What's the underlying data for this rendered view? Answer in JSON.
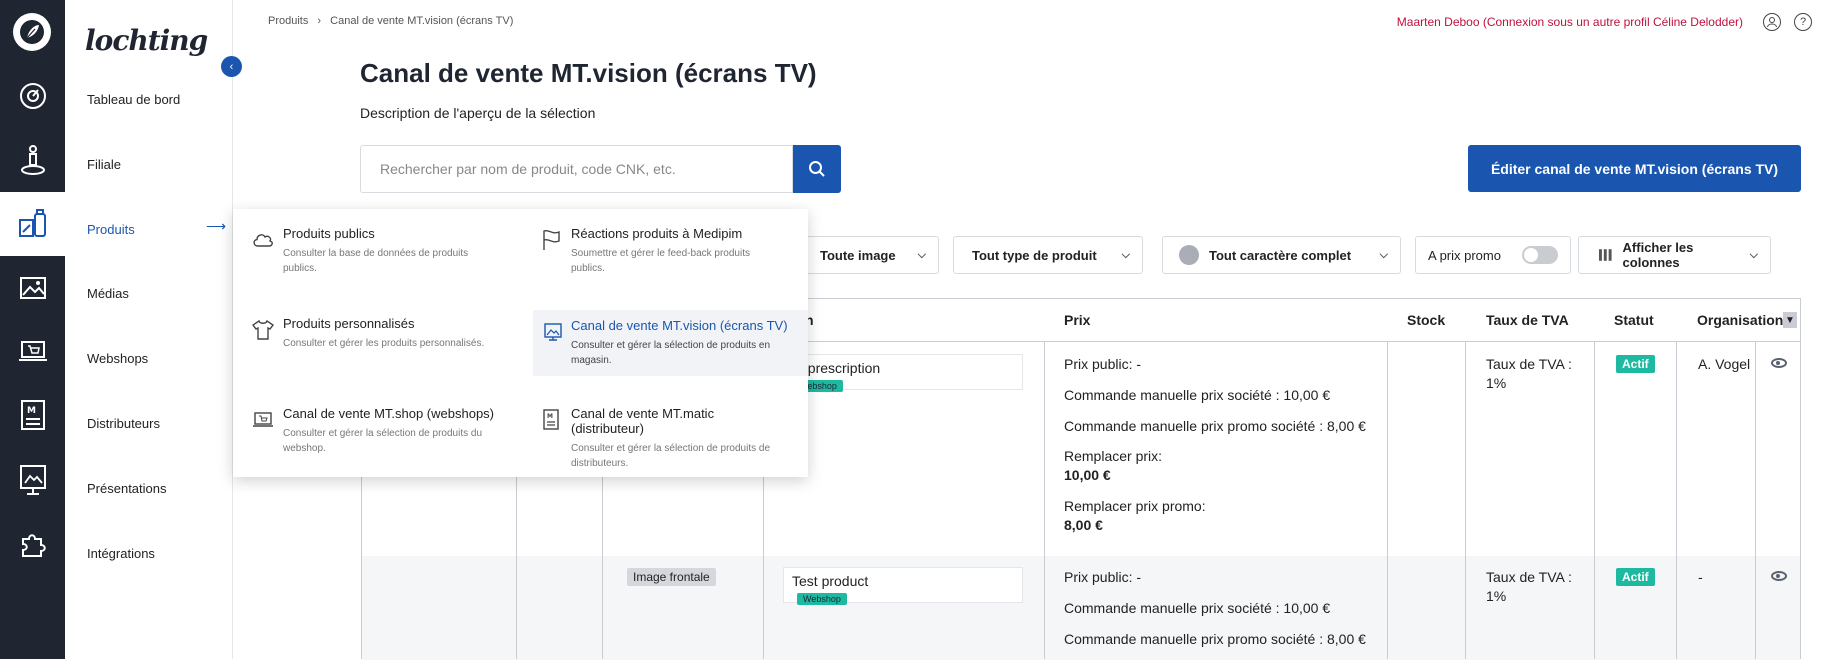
{
  "rail": {
    "items": [
      "dashboard-icon",
      "store-icon",
      "products-icon",
      "media-icon",
      "webshop-icon",
      "distributor-icon",
      "presentation-icon",
      "integration-icon"
    ]
  },
  "sidebar": {
    "brand": "lochting",
    "items": [
      {
        "label": "Tableau de bord"
      },
      {
        "label": "Filiale"
      },
      {
        "label": "Produits"
      },
      {
        "label": "Médias"
      },
      {
        "label": "Webshops"
      },
      {
        "label": "Distributeurs"
      },
      {
        "label": "Présentations"
      },
      {
        "label": "Intégrations"
      }
    ]
  },
  "breadcrumb": {
    "root": "Produits",
    "sep": "›",
    "current": "Canal de vente MT.vision (écrans TV)"
  },
  "user": {
    "line": "Maarten Deboo (Connexion sous un autre profil Céline Delodder)",
    "help": "?"
  },
  "page": {
    "title": "Canal de vente MT.vision (écrans TV)",
    "description": "Description de l'aperçu de la sélection",
    "search_placeholder": "Rechercher par nom de produit, code CNK, etc.",
    "edit_button": "Éditer canal de vente MT.vision (écrans TV)"
  },
  "filters": {
    "image": "Toute image",
    "type": "Tout type de produit",
    "complete": "Tout caractère complet",
    "promo": "A prix promo",
    "promo_on": false,
    "columns": "Afficher les colonnes"
  },
  "table": {
    "headers": [
      "n",
      "Prix",
      "Stock",
      "Taux de TVA",
      "Statut",
      "Organisation"
    ],
    "rows": [
      {
        "name": "st prescription",
        "tag": "Webshop",
        "price_public": "Prix public: -",
        "price_manual": "Commande manuelle prix société : 10,00 €",
        "price_manual_promo": "Commande manuelle prix promo société : 8,00 €",
        "replace_label": "Remplacer prix:",
        "replace_value": "10,00 €",
        "replace_promo_label": "Remplacer prix promo:",
        "replace_promo_value": "8,00 €",
        "vat_label": "Taux de TVA :",
        "vat_value": "1%",
        "status": "Actif",
        "org": "A. Vogel"
      },
      {
        "image_tag": "Image frontale",
        "name": "Test product",
        "tag": "Webshop",
        "price_public": "Prix public: -",
        "price_manual": "Commande manuelle prix société : 10,00 €",
        "price_manual_promo": "Commande manuelle prix promo société : 8,00 €",
        "vat_label": "Taux de TVA :",
        "vat_value": "1%",
        "status": "Actif",
        "org": "-"
      }
    ]
  },
  "menu": {
    "items": [
      {
        "title": "Produits publics",
        "desc": "Consulter la base de données de produits publics.",
        "icon": "cloud-icon"
      },
      {
        "title": "Réactions produits à Medipim",
        "desc": "Soumettre et gérer le feed-back produits publics.",
        "icon": "flag-icon"
      },
      {
        "title": "Produits personnalisés",
        "desc": "Consulter et gérer les produits personnalisés.",
        "icon": "shirt-icon"
      },
      {
        "title": "Canal de vente MT.vision (écrans TV)",
        "desc": "Consulter et gérer la sélection de produits en magasin.",
        "icon": "tv-image-icon",
        "selected": true
      },
      {
        "title": "Canal de vente MT.shop (webshops)",
        "desc": "Consulter et gérer la sélection de produits du webshop.",
        "icon": "laptop-cart-icon"
      },
      {
        "title": "Canal de vente MT.matic (distributeur)",
        "desc": "Consulter et gérer la sélection de produits de distributeurs.",
        "icon": "kiosk-icon"
      }
    ]
  },
  "colors": {
    "accent": "#1a56b0",
    "rail": "#1f2631",
    "status": "#1db9a0",
    "user": "#c0113d"
  }
}
